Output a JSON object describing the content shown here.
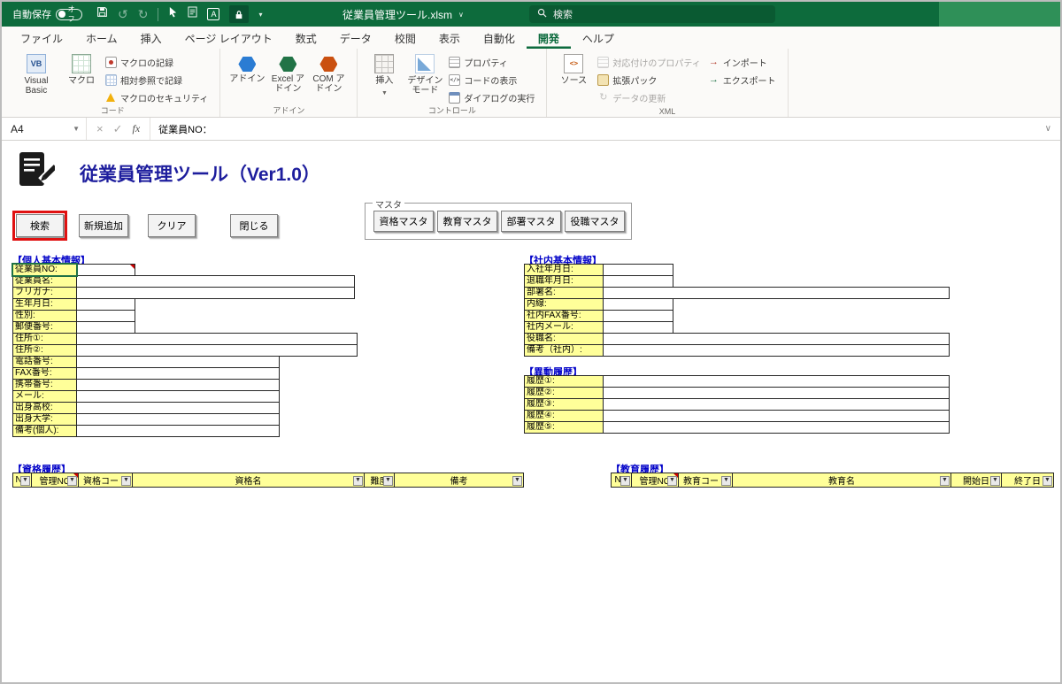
{
  "window": {
    "titlebar": {
      "autosave_label": "自動保存",
      "autosave_state": "オフ",
      "title": "従業員管理ツール.xlsm",
      "search_label": "検索"
    },
    "tabs": [
      "ファイル",
      "ホーム",
      "挿入",
      "ページ レイアウト",
      "数式",
      "データ",
      "校閲",
      "表示",
      "自動化",
      "開発",
      "ヘルプ"
    ],
    "active_tab": "開発"
  },
  "ribbon": {
    "code_group": {
      "label": "コード",
      "visual_basic": "Visual Basic",
      "macro": "マクロ",
      "items": [
        "マクロの記録",
        "相対参照で記録",
        "マクロのセキュリティ"
      ]
    },
    "addin_group": {
      "label": "アドイン",
      "buttons": [
        "アドイン",
        "Excel アドイン",
        "COM アドイン"
      ]
    },
    "control_group": {
      "label": "コントロール",
      "insert": "挿入",
      "design_mode": "デザイン モード",
      "items": [
        "プロパティ",
        "コードの表示",
        "ダイアログの実行"
      ]
    },
    "xml_group": {
      "label": "XML",
      "source": "ソース",
      "items_left": [
        {
          "label": "対応付けのプロパティ",
          "disabled": true
        },
        {
          "label": "拡張パック",
          "disabled": false
        },
        {
          "label": "データの更新",
          "disabled": true
        }
      ],
      "items_right": [
        {
          "label": "インポート",
          "disabled": false
        },
        {
          "label": "エクスポート",
          "disabled": false
        }
      ]
    }
  },
  "formula_bar": {
    "name_box": "A4",
    "content": "従業員NO："
  },
  "sheet": {
    "title": "従業員管理ツール（Ver1.0）",
    "buttons": [
      {
        "label": "検索",
        "highlighted": true
      },
      {
        "label": "新規追加",
        "highlighted": false
      },
      {
        "label": "クリア",
        "highlighted": false
      },
      {
        "label": "閉じる",
        "highlighted": false
      }
    ],
    "master": {
      "label": "マスタ",
      "buttons": [
        "資格マスタ",
        "教育マスタ",
        "部署マスタ",
        "役職マスタ"
      ]
    },
    "personal": {
      "heading": "【個人基本情報】",
      "rows": [
        {
          "label": "従業員NO:",
          "size": "s",
          "note": true,
          "selected": true
        },
        {
          "label": "従業員名:",
          "size": "l"
        },
        {
          "label": "フリガナ:",
          "size": "l"
        },
        {
          "label": "生年月日:",
          "size": "s"
        },
        {
          "label": "性別:",
          "size": "s"
        },
        {
          "label": "郵便番号:",
          "size": "s"
        },
        {
          "label": "住所①:",
          "size": "xl"
        },
        {
          "label": "住所②:",
          "size": "xl"
        },
        {
          "label": "電話番号:",
          "size": "m"
        },
        {
          "label": "FAX番号:",
          "size": "m"
        },
        {
          "label": "携帯番号:",
          "size": "m"
        },
        {
          "label": "メール:",
          "size": "m"
        },
        {
          "label": "出身高校:",
          "size": "m"
        },
        {
          "label": "出身大学:",
          "size": "m"
        },
        {
          "label": "備考(個人):",
          "size": "m"
        }
      ]
    },
    "company": {
      "heading": "【社内基本情報】",
      "rows": [
        {
          "label": "入社年月日:",
          "size": "s"
        },
        {
          "label": "退職年月日:",
          "size": "s"
        },
        {
          "label": "部署名:",
          "size": "l"
        },
        {
          "label": "内線:",
          "size": "s"
        },
        {
          "label": "社内FAX番号:",
          "size": "s"
        },
        {
          "label": "社内メール:",
          "size": "s"
        },
        {
          "label": "役職名:",
          "size": "l"
        },
        {
          "label": "備考（社内）:",
          "size": "l"
        }
      ]
    },
    "transfer": {
      "heading": "【異動履歴】",
      "rows": [
        {
          "label": "履歴①:",
          "size": "l"
        },
        {
          "label": "履歴②:",
          "size": "l"
        },
        {
          "label": "履歴③:",
          "size": "l"
        },
        {
          "label": "履歴④:",
          "size": "l"
        },
        {
          "label": "履歴⑤:",
          "size": "l"
        }
      ]
    },
    "qualification": {
      "heading": "【資格履歴】",
      "columns": [
        {
          "label": "NO"
        },
        {
          "label": "管理NO",
          "note": true
        },
        {
          "label": "資格コード"
        },
        {
          "label": "資格名"
        },
        {
          "label": "難度"
        },
        {
          "label": "備考"
        }
      ]
    },
    "education": {
      "heading": "【教育履歴】",
      "columns": [
        {
          "label": "NO"
        },
        {
          "label": "管理NO",
          "note": true
        },
        {
          "label": "教育コード"
        },
        {
          "label": "教育名"
        },
        {
          "label": "開始日"
        },
        {
          "label": "終了日"
        }
      ]
    }
  }
}
